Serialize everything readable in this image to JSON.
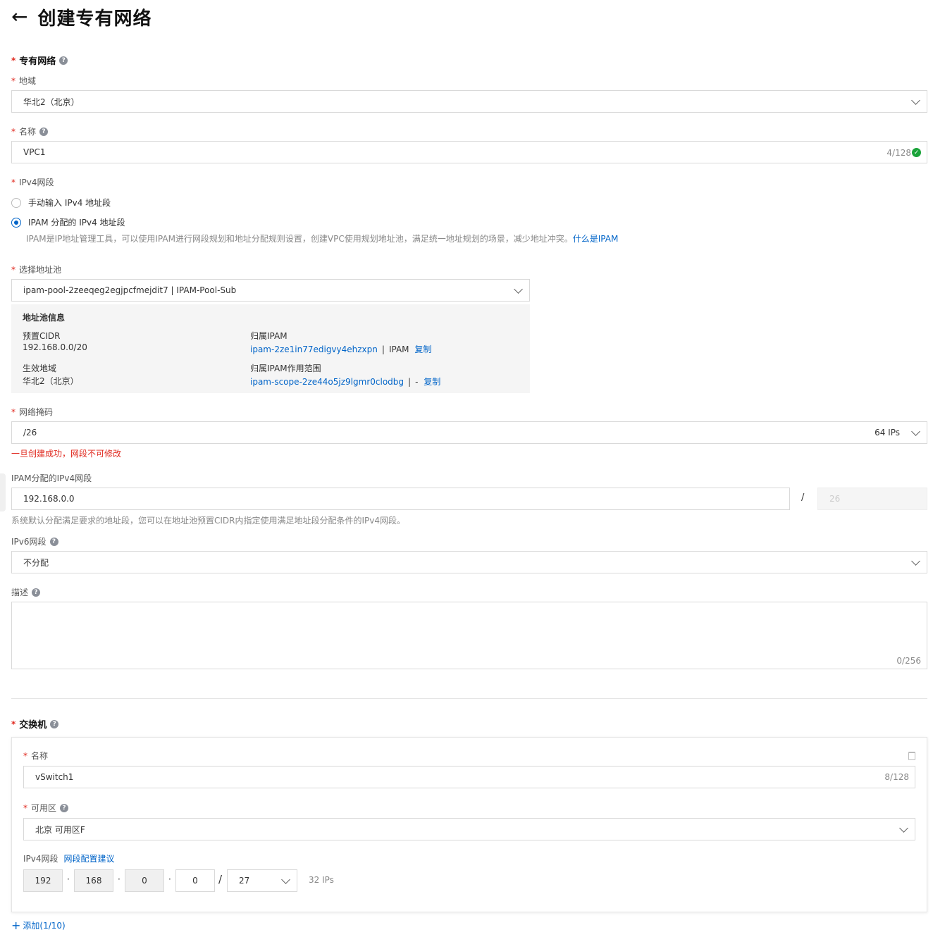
{
  "header": {
    "title": "创建专有网络",
    "back_icon": "arrow-left-icon"
  },
  "vpc": {
    "section_title": "专有网络",
    "region": {
      "label": "地域",
      "value": "华北2（北京）"
    },
    "name": {
      "label": "名称",
      "value": "VPC1",
      "counter": "4/128"
    },
    "ipv4": {
      "label": "IPv4网段",
      "option_manual": "手动输入 IPv4 地址段",
      "option_ipam": "IPAM 分配的 IPv4 地址段",
      "ipam_hint": "IPAM是IP地址管理工具，可以使用IPAM进行网段规划和地址分配规则设置，创建VPC使用规划地址池，满足统一地址规划的场景，减少地址冲突。",
      "ipam_link": "什么是IPAM"
    },
    "pool": {
      "label": "选择地址池",
      "value": "ipam-pool-2zeeqeg2egjpcfmejdit7 | IPAM-Pool-Sub",
      "info_title": "地址池信息",
      "cidr_key": "预置CIDR",
      "cidr_val": "192.168.0.0/20",
      "region_key": "生效地域",
      "region_val": "华北2（北京）",
      "ipam_key": "归属IPAM",
      "ipam_id": "ipam-2ze1in77edigvy4ehzxpn",
      "ipam_sep": "|",
      "ipam_name": "IPAM",
      "copy1": "复制",
      "scope_key": "归属IPAM作用范围",
      "scope_id": "ipam-scope-2ze44o5jz9lgmr0clodbg",
      "scope_sep": "|",
      "scope_name": "-",
      "copy2": "复制"
    },
    "mask": {
      "label": "网络掩码",
      "value": "/26",
      "ips": "64 IPs",
      "warning": "一旦创建成功，网段不可修改"
    },
    "ipam_cidr": {
      "label": "IPAM分配的IPv4网段",
      "value": "192.168.0.0",
      "slash": "/",
      "prefix": "26",
      "hint": "系统默认分配满足要求的地址段，您可以在地址池预置CIDR内指定使用满足地址段分配条件的IPv4网段。"
    },
    "ipv6": {
      "label": "IPv6网段",
      "value": "不分配"
    },
    "desc": {
      "label": "描述",
      "counter": "0/256"
    }
  },
  "vswitch": {
    "section_title": "交换机",
    "name": {
      "label": "名称",
      "value": "vSwitch1",
      "counter": "8/128"
    },
    "zone": {
      "label": "可用区",
      "value": "北京 可用区F"
    },
    "ipv4": {
      "label": "IPv4网段",
      "link": "网段配置建议",
      "octets": [
        "192",
        "168",
        "0",
        "0"
      ],
      "dot": "·",
      "slash": "/",
      "prefix": "27",
      "ips": "32 IPs"
    },
    "add": "添加(1/10)"
  },
  "colors": {
    "accent": "#0064c8",
    "required": "#e0281e",
    "ok": "#1ba33a"
  }
}
